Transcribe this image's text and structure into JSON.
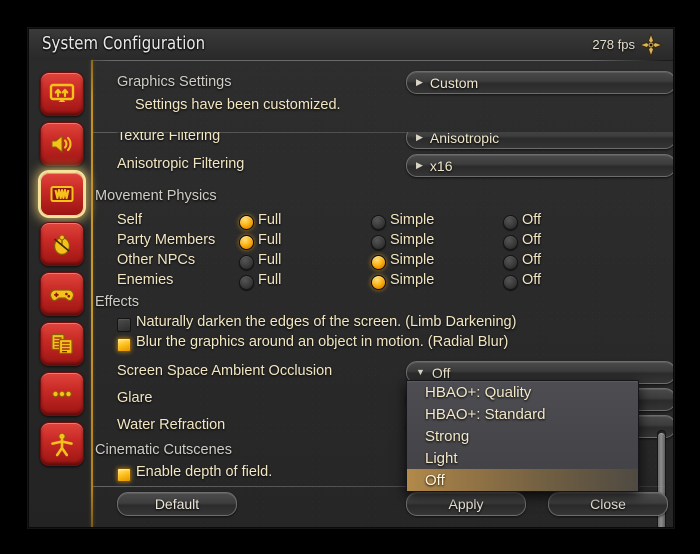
{
  "window": {
    "title": "System Configuration",
    "fps": "278 fps",
    "fps_icon": "compass-cross-icon"
  },
  "sidebar": {
    "items": [
      {
        "name": "display-settings",
        "icon": "monitor-icon",
        "selected": false
      },
      {
        "name": "sound-settings",
        "icon": "speaker-icon",
        "selected": false
      },
      {
        "name": "graphics-settings",
        "icon": "graphics-card-icon",
        "selected": true
      },
      {
        "name": "mouse-settings",
        "icon": "mouse-icon",
        "selected": false
      },
      {
        "name": "gamepad-settings",
        "icon": "gamepad-icon",
        "selected": false
      },
      {
        "name": "log-settings",
        "icon": "documents-icon",
        "selected": false
      },
      {
        "name": "other-settings",
        "icon": "three-dots-icon",
        "selected": false
      },
      {
        "name": "character-settings",
        "icon": "person-icon",
        "selected": false
      }
    ]
  },
  "header": {
    "section_label": "Graphics Settings",
    "status_text": "Settings have been customized.",
    "preset_value": "Custom"
  },
  "scroll_rows": {
    "texture_filtering": {
      "label": "Texture Filtering",
      "value": "Anisotropic"
    },
    "anisotropic_filtering": {
      "label": "Anisotropic Filtering",
      "value": "x16"
    }
  },
  "movement_physics": {
    "section": "Movement Physics",
    "columns": [
      "Full",
      "Simple",
      "Off"
    ],
    "rows": [
      {
        "label": "Self",
        "selected": 0
      },
      {
        "label": "Party Members",
        "selected": 0
      },
      {
        "label": "Other NPCs",
        "selected": 1
      },
      {
        "label": "Enemies",
        "selected": 1
      }
    ]
  },
  "effects": {
    "section": "Effects",
    "checkboxes": [
      {
        "label": "Naturally darken the edges of the screen. (Limb Darkening)",
        "checked": false
      },
      {
        "label": "Blur the graphics around an object in motion. (Radial Blur)",
        "checked": true
      }
    ],
    "ssao": {
      "label": "Screen Space Ambient Occlusion",
      "value": "Off"
    },
    "glare": {
      "label": "Glare"
    },
    "water_refraction": {
      "label": "Water Refraction"
    }
  },
  "cinematic": {
    "section": "Cinematic Cutscenes",
    "checkbox": {
      "label": "Enable depth of field.",
      "checked": true
    }
  },
  "dropdown_open": {
    "for": "Screen Space Ambient Occlusion",
    "options": [
      "HBAO+: Quality",
      "HBAO+: Standard",
      "Strong",
      "Light",
      "Off"
    ],
    "selected": "Off",
    "selected_index": 4
  },
  "footer": {
    "default_label": "Default",
    "apply_label": "Apply",
    "close_label": "Close"
  },
  "colors": {
    "accent_gold": "#c79a2b",
    "radio_on": "#ffb518",
    "value_text": "#f0e3bc",
    "label_text": "#cfccc4",
    "window_bg": "#2a2a2a",
    "nav_red": "#c92a26"
  }
}
